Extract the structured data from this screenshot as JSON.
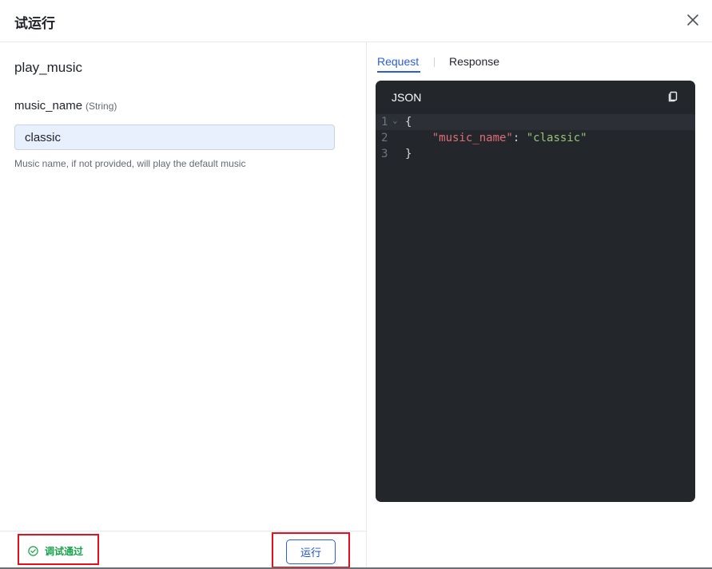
{
  "dialog": {
    "title": "试运行"
  },
  "request_form": {
    "function_name": "play_music",
    "param": {
      "name": "music_name",
      "type": "(String)",
      "value": "classic",
      "description": "Music name, if not provided, will play the default music"
    }
  },
  "footer": {
    "status_text": "调试通过",
    "run_label": "运行"
  },
  "tabs": [
    {
      "label": "Request",
      "active": true
    },
    {
      "label": "Response",
      "active": false
    }
  ],
  "code": {
    "language": "JSON",
    "line_numbers": [
      "1",
      "2",
      "3"
    ],
    "open_brace": "{",
    "key": "\"music_name\"",
    "colon": ": ",
    "value": "\"classic\"",
    "close_brace": "}"
  },
  "colors": {
    "accent": "#2b5fd9",
    "success": "#17a34a",
    "highlight_border": "#e5101e",
    "editor_bg": "#23262b"
  }
}
